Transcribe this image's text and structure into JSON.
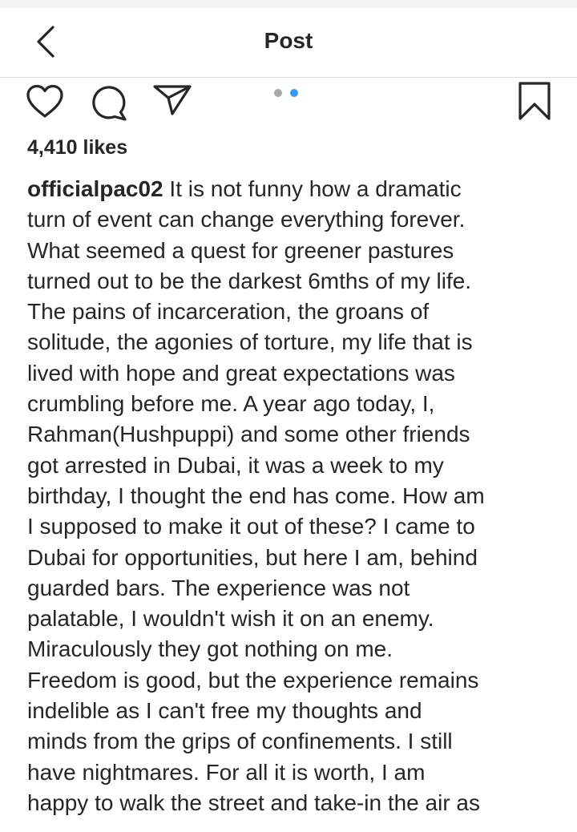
{
  "header": {
    "title": "Post"
  },
  "icons": {
    "back": "chevron-left-icon",
    "like": "heart-icon",
    "comment": "comment-bubble-icon",
    "share": "paper-plane-icon",
    "save": "bookmark-icon"
  },
  "carousel": {
    "total": 2,
    "active": 2
  },
  "post": {
    "likes": "4,410 likes",
    "username": "officialpac02",
    "caption_lines": [
      " It is not funny how a dramatic",
      "turn of event can change everything forever.",
      "What seemed a quest for greener pastures",
      "turned out to be the darkest 6mths of my life.",
      "The pains of incarceration, the groans of",
      "solitude, the agonies of torture, my life that is",
      "lived with hope and great expectations was",
      "crumbling before me. A year ago today, I,",
      "Rahman(Hushpuppi) and some other friends",
      "got arrested in Dubai, it was a week to my",
      "birthday, I thought the end has come. How am",
      "I supposed to make it out of these? I came to",
      "Dubai for opportunities, but here I am, behind",
      "guarded bars. The experience was not",
      "palatable, I wouldn't wish it on an enemy.",
      "Miraculously they got nothing on me.",
      "Freedom is good, but the experience remains",
      "indelible as I can't free my thoughts and",
      "minds from the grips of confinements. I still",
      "have nightmares. For all it is worth, I am",
      "happy to walk the street and take-in the air as"
    ]
  },
  "colors": {
    "text": "#262626",
    "divider": "#dbdbdb",
    "dot_inactive": "#a8a8a8",
    "dot_active": "#3897f0"
  }
}
